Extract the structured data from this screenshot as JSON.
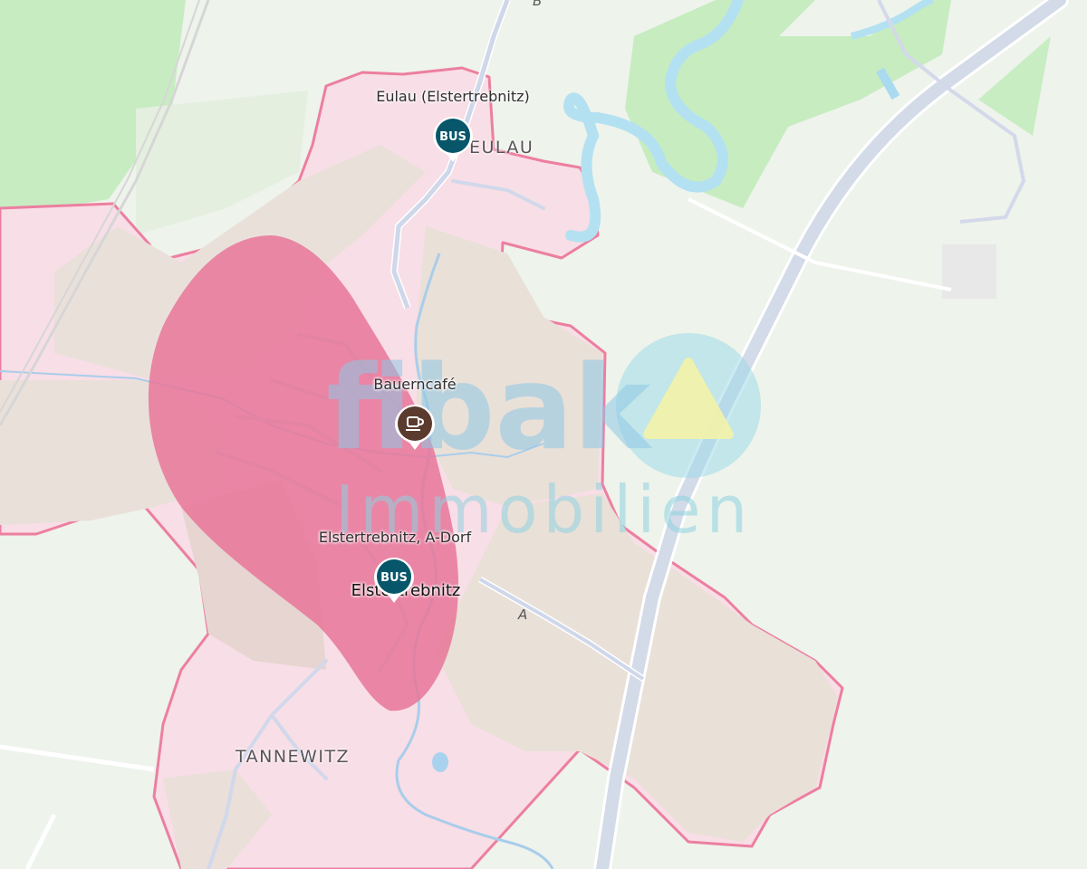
{
  "map": {
    "places": {
      "eulau": "EULAU",
      "tannewitz": "TANNEWITZ"
    },
    "pois": [
      {
        "label": "Eulau (Elstertrebnitz)",
        "badge": "BUS",
        "icon": "bus-icon"
      },
      {
        "label": "Bauerncafé",
        "icon": "cafe-cup-icon"
      },
      {
        "label": "Elstertrebnitz, A-Dorf",
        "badge": "BUS",
        "icon": "bus-icon"
      }
    ],
    "town_label": "Elstertrebnitz",
    "road_labels": [
      "B",
      "A"
    ],
    "watermark": {
      "line1": "fibak",
      "line2": "Immobilien"
    },
    "colors": {
      "background": "#eef3ec",
      "forest": "#c6ecc0",
      "water": "#b3e1f2",
      "boundary": "#ec7fa0",
      "boundary_fill": "#f7dde5",
      "settlement": "#eadfd9",
      "highlight": "#e77699",
      "bus_marker": "#07566a",
      "cafe_marker": "#5b3b2e"
    }
  }
}
